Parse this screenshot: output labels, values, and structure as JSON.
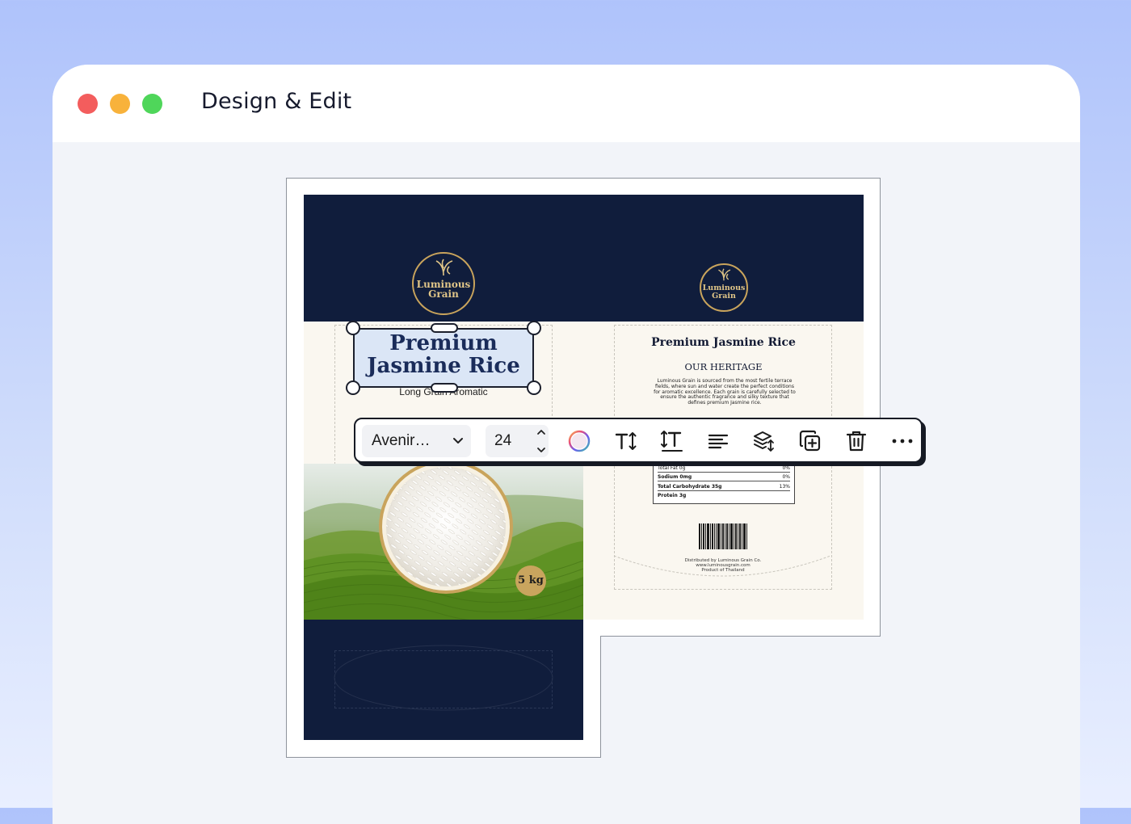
{
  "window": {
    "title": "Design & Edit"
  },
  "front_panel": {
    "logo_line1": "Luminous",
    "logo_line2": "Grain",
    "title": "Premium Jasmine Rice",
    "title_line1": "Premium",
    "title_line2": "Jasmine Rice",
    "subtitle": "Long Grain Aromatic",
    "size_badge": "5 kg"
  },
  "back_panel": {
    "logo_line1": "Luminous",
    "logo_line2": "Grain",
    "title": "Premium Jasmine Rice",
    "heritage_heading": "OUR HERITAGE",
    "heritage_text": "Luminous Grain is sourced from the most fertile terrace fields, where sun and water create the perfect conditions for aromatic excellence. Each grain is carefully selected to ensure the authentic fragrance and silky texture that defines premium Jasmine rice.",
    "nutrition_rows": [
      {
        "name": "Total Fat 0g",
        "pct": "0%"
      },
      {
        "name": "Sodium 0mg",
        "pct": "0%"
      },
      {
        "name": "Total Carbohydrate 35g",
        "pct": "13%"
      },
      {
        "name": "Protein 3g",
        "pct": ""
      }
    ],
    "distributor_line1": "Distributed by Luminous Grain Co.",
    "distributor_line2": "www.luminousgrain.com",
    "distributor_line3": "Product of Thailand"
  },
  "toolbar": {
    "font_family": "Avenir…",
    "font_size": "24",
    "icons": [
      "color-picker-icon",
      "text-height-icon",
      "line-height-icon",
      "align-left-icon",
      "layers-icon",
      "duplicate-icon",
      "delete-icon",
      "more-options-icon"
    ]
  },
  "colors": {
    "navy": "#101d3c",
    "gold": "#c9a45c",
    "cream": "#faf7f0",
    "selection_fill": "#dbe6f6"
  }
}
